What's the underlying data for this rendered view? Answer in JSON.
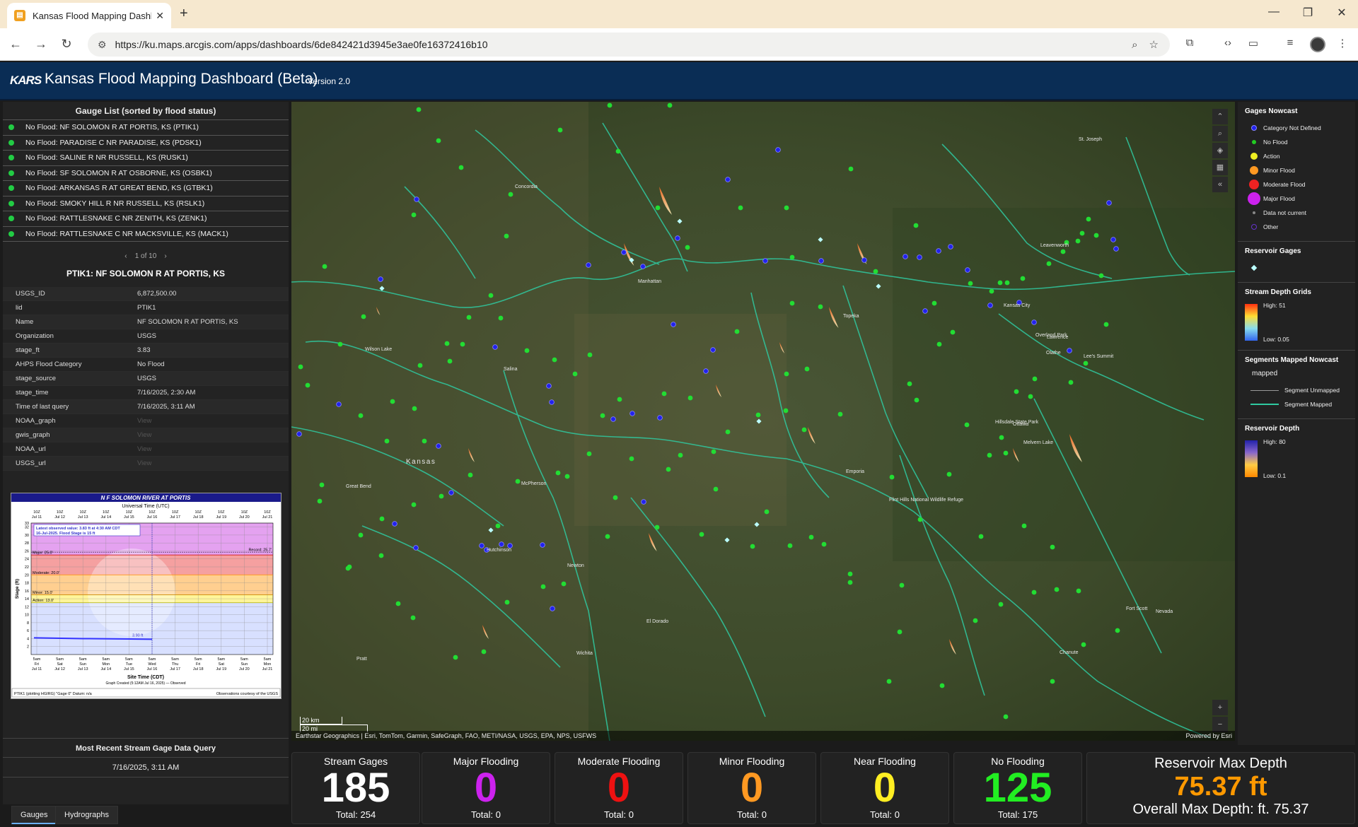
{
  "browser": {
    "tab_title": "Kansas Flood Mapping Dashbo",
    "url": "https://ku.maps.arcgis.com/apps/dashboards/6de842421d3945e3ae0fe16372416b10"
  },
  "header": {
    "logo": "KARS",
    "title": "Kansas Flood Mapping Dashboard (Beta)",
    "version": "Version 2.0"
  },
  "gauge_list": {
    "title": "Gauge List (sorted by flood status)",
    "items": [
      {
        "label": "No Flood: NF SOLOMON R AT PORTIS, KS (PTIK1)"
      },
      {
        "label": "No Flood: PARADISE C NR PARADISE, KS (PDSK1)"
      },
      {
        "label": "No Flood: SALINE R NR RUSSELL, KS (RUSK1)"
      },
      {
        "label": "No Flood: SF SOLOMON R AT OSBORNE, KS (OSBK1)"
      },
      {
        "label": "No Flood: ARKANSAS R AT GREAT BEND, KS (GTBK1)"
      },
      {
        "label": "No Flood: SMOKY HILL R NR RUSSELL, KS (RSLK1)"
      },
      {
        "label": "No Flood: RATTLESNAKE C NR ZENITH, KS (ZENK1)"
      },
      {
        "label": "No Flood: RATTLESNAKE C NR MACKSVILLE, KS (MACK1)"
      }
    ],
    "pager": "1 of 10"
  },
  "detail": {
    "title": "PTIK1: NF SOLOMON R AT PORTIS, KS",
    "rows": [
      {
        "k": "USGS_ID",
        "v": "6,872,500.00"
      },
      {
        "k": "lid",
        "v": "PTIK1"
      },
      {
        "k": "Name",
        "v": "NF SOLOMON R AT PORTIS, KS"
      },
      {
        "k": "Organization",
        "v": "USGS"
      },
      {
        "k": "stage_ft",
        "v": "3.83"
      },
      {
        "k": "AHPS Flood Category",
        "v": "No Flood"
      },
      {
        "k": "stage_source",
        "v": "USGS"
      },
      {
        "k": "stage_time",
        "v": "7/16/2025, 2:30 AM"
      },
      {
        "k": "Time of last query",
        "v": "7/16/2025, 3:11 AM"
      },
      {
        "k": "NOAA_graph",
        "v": "View"
      },
      {
        "k": "gwis_graph",
        "v": "View"
      },
      {
        "k": "NOAA_url",
        "v": "View"
      },
      {
        "k": "USGS_url",
        "v": "View"
      }
    ]
  },
  "hydrograph": {
    "title": "N F SOLOMON RIVER AT PORTIS",
    "top_axis": "Universal Time (UTC)",
    "bottom_axis": "Site Time (CDT)",
    "ylabel": "Stage (ft)",
    "top_ticks": [
      [
        "10Z",
        "Jul 11"
      ],
      [
        "10Z",
        "Jul 12"
      ],
      [
        "10Z",
        "Jul 13"
      ],
      [
        "10Z",
        "Jul 14"
      ],
      [
        "10Z",
        "Jul 15"
      ],
      [
        "10Z",
        "Jul 16"
      ],
      [
        "10Z",
        "Jul 17"
      ],
      [
        "10Z",
        "Jul 18"
      ],
      [
        "10Z",
        "Jul 19"
      ],
      [
        "10Z",
        "Jul 20"
      ],
      [
        "10Z",
        "Jul 21"
      ]
    ],
    "bottom_ticks": [
      [
        "5am",
        "Fri",
        "Jul 11"
      ],
      [
        "5am",
        "Sat",
        "Jul 12"
      ],
      [
        "5am",
        "Sun",
        "Jul 13"
      ],
      [
        "5am",
        "Mon",
        "Jul 14"
      ],
      [
        "5am",
        "Tue",
        "Jul 15"
      ],
      [
        "5am",
        "Wed",
        "Jul 16"
      ],
      [
        "5am",
        "Thu",
        "Jul 17"
      ],
      [
        "5am",
        "Fri",
        "Jul 18"
      ],
      [
        "5am",
        "Sat",
        "Jul 19"
      ],
      [
        "5am",
        "Sun",
        "Jul 20"
      ],
      [
        "5am",
        "Mon",
        "Jul 21"
      ]
    ],
    "y_ticks": [
      "33",
      "32",
      "30",
      "28",
      "26",
      "24",
      "22",
      "20",
      "18",
      "16",
      "14",
      "12",
      "10",
      "8",
      "6",
      "4",
      "2"
    ],
    "latest_box": "Latest observed value: 3.83 ft at 4:30 AM CDT",
    "latest_box2": "16-Jul-2025.  Flood Stage is 15 ft",
    "record": "Record: 25.7'",
    "major": "Major: 25.0'",
    "moderate": "Moderate: 20.0'",
    "minor": "Minor: 15.0'",
    "action": "Action: 13.0'",
    "obs_label": "3.90 ft",
    "legend": "Graph Created (5:12AM Jul 16, 2025)   — Observed",
    "footer_left": "PTIK1 (plotting HGIRG) \"Gage 0\" Datum: n/a",
    "footer_right": "Observations courtesy of the USGS"
  },
  "query": {
    "title": "Most Recent Stream Gage Data Query",
    "value": "7/16/2025, 3:11 AM"
  },
  "left_tabs": [
    "Gauges",
    "Hydrographs"
  ],
  "map": {
    "attribution": "Earthstar Geographics | Esri, TomTom, Garmin, SafeGraph, FAO, METI/NASA, USGS, EPA, NPS, USFWS",
    "powered": "Powered by Esri",
    "scale_km": "20 km",
    "scale_mi": "20 mi",
    "places": [
      "Concordia",
      "Manhattan",
      "Topeka",
      "Kansas City",
      "Lawrence",
      "Overland Park",
      "Olathe",
      "Lee's Summit",
      "Leavenworth",
      "St. Joseph",
      "Salina",
      "Kansas",
      "Great Bend",
      "McPherson",
      "Hutchinson",
      "Newton",
      "Emporia",
      "Wichita",
      "El Dorado",
      "Ottawa",
      "Fort Scott",
      "Nevada",
      "Chanute",
      "Hillsdale State Park",
      "Flint Hills National Wildlife Refuge",
      "Melvern Lake",
      "Pratt",
      "Wilson Lake"
    ]
  },
  "legend": {
    "gages_title": "Gages Nowcast",
    "gages": [
      {
        "label": "Category Not Defined",
        "color": "#2222ee"
      },
      {
        "label": "No Flood",
        "color": "#22cc22"
      },
      {
        "label": "Action",
        "color": "#eeee22"
      },
      {
        "label": "Minor Flood",
        "color": "#ff9922"
      },
      {
        "label": "Moderate Flood",
        "color": "#ee2222"
      },
      {
        "label": "Major Flood",
        "color": "#cc22ee"
      },
      {
        "label": "Data not current",
        "color": "#888888"
      },
      {
        "label": "Other",
        "color": "#6633cc"
      }
    ],
    "reservoir_title": "Reservoir Gages",
    "depth_title": "Stream Depth Grids",
    "depth_high": "High: 51",
    "depth_low": "Low: 0.05",
    "segments_title": "Segments Mapped Nowcast",
    "segments_sub": "mapped",
    "seg_unmapped": "Segment Unmapped",
    "seg_mapped": "Segment Mapped",
    "res_depth_title": "Reservoir Depth",
    "res_high": "High: 80",
    "res_low": "Low: 0.1"
  },
  "stats": [
    {
      "title": "Stream Gages",
      "value": "185",
      "total": "Total: 254",
      "color": "#ffffff"
    },
    {
      "title": "Major Flooding",
      "value": "0",
      "total": "Total: 0",
      "color": "#cc22ee"
    },
    {
      "title": "Moderate Flooding",
      "value": "0",
      "total": "Total: 0",
      "color": "#ee1111"
    },
    {
      "title": "Minor Flooding",
      "value": "0",
      "total": "Total: 0",
      "color": "#ff9922"
    },
    {
      "title": "Near Flooding",
      "value": "0",
      "total": "Total: 0",
      "color": "#ffee22"
    },
    {
      "title": "No Flooding",
      "value": "125",
      "total": "Total: 175",
      "color": "#22ee22"
    }
  ],
  "reservoir": {
    "title": "Reservoir Max Depth",
    "value": "75.37 ft",
    "overall": "Overall Max Depth: ft. 75.37"
  }
}
